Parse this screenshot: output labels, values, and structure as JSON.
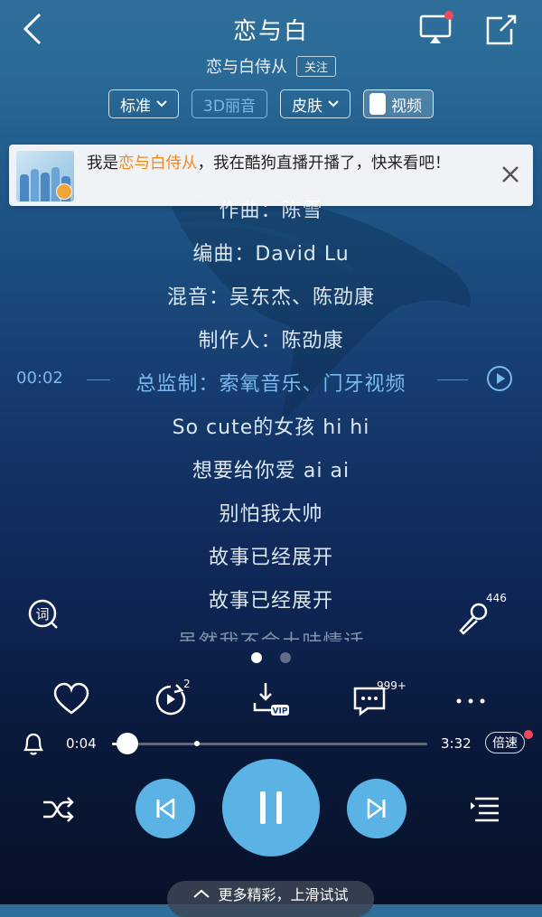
{
  "header": {
    "title": "恋与白",
    "artist": "恋与白侍从",
    "follow_label": "关注",
    "pills": {
      "quality": "标准",
      "audio_3d": "3D丽音",
      "skin": "皮肤",
      "video": "视频"
    }
  },
  "banner": {
    "text_prefix": "我是",
    "highlight_name": "恋与白侍从",
    "text_suffix": "，我在酷狗直播开播了，快来看吧！"
  },
  "lyrics": {
    "lines": [
      "作曲：陈雪",
      "编曲：David Lu",
      "混音：吴东杰、陈劭康",
      "制作人：陈劭康",
      "总监制：索氧音乐、门牙视频",
      "So cute的女孩 hi hi",
      "想要给你爱 ai ai",
      "别怕我太帅",
      "故事已经展开",
      "故事已经展开",
      "虽然我不会土味情话"
    ],
    "marker_time": "00:02",
    "current_index": 4
  },
  "side": {
    "ci_icon": "lyrics-word-icon",
    "mic_count": "446"
  },
  "pager": {
    "count": 2,
    "active": 0
  },
  "actions": {
    "countdown_badge": "2",
    "comment_badge": "999+"
  },
  "player": {
    "current_time": "0:04",
    "total_time": "3:32",
    "progress": 0.05,
    "buffered": 0.27,
    "speed_label": "倍速"
  },
  "footer": {
    "more_label": "更多精彩，上滑试试"
  },
  "colors": {
    "accent": "#5ab2e5",
    "current_lyric": "#7ab9ee",
    "highlight": "#f28a1e",
    "red_dot": "#f0495a"
  }
}
